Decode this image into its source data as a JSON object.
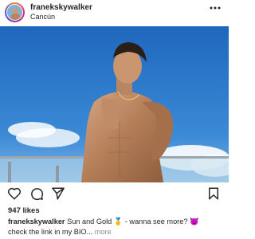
{
  "post": {
    "username": "franekskywalker",
    "location": "Cancún",
    "more_icon": "ellipsis-icon",
    "more_glyph": "•••",
    "likes": "947 likes",
    "caption": {
      "username": "franekskywalker",
      "text_part1": " Sun and Gold ",
      "emoji1": "🥇",
      "text_part2": " - wanna see more? ",
      "emoji2": "😈",
      "text_line2": "check the link in my BIO...",
      "more_link": "more"
    }
  },
  "actions": {
    "like_icon": "heart-icon",
    "comment_icon": "comment-icon",
    "share_icon": "send-icon",
    "save_icon": "bookmark-icon"
  },
  "colors": {
    "text": "#262626",
    "muted": "#8e8e8e",
    "sky": "#2f79c8",
    "emoji_purple": "#8e44ad"
  }
}
